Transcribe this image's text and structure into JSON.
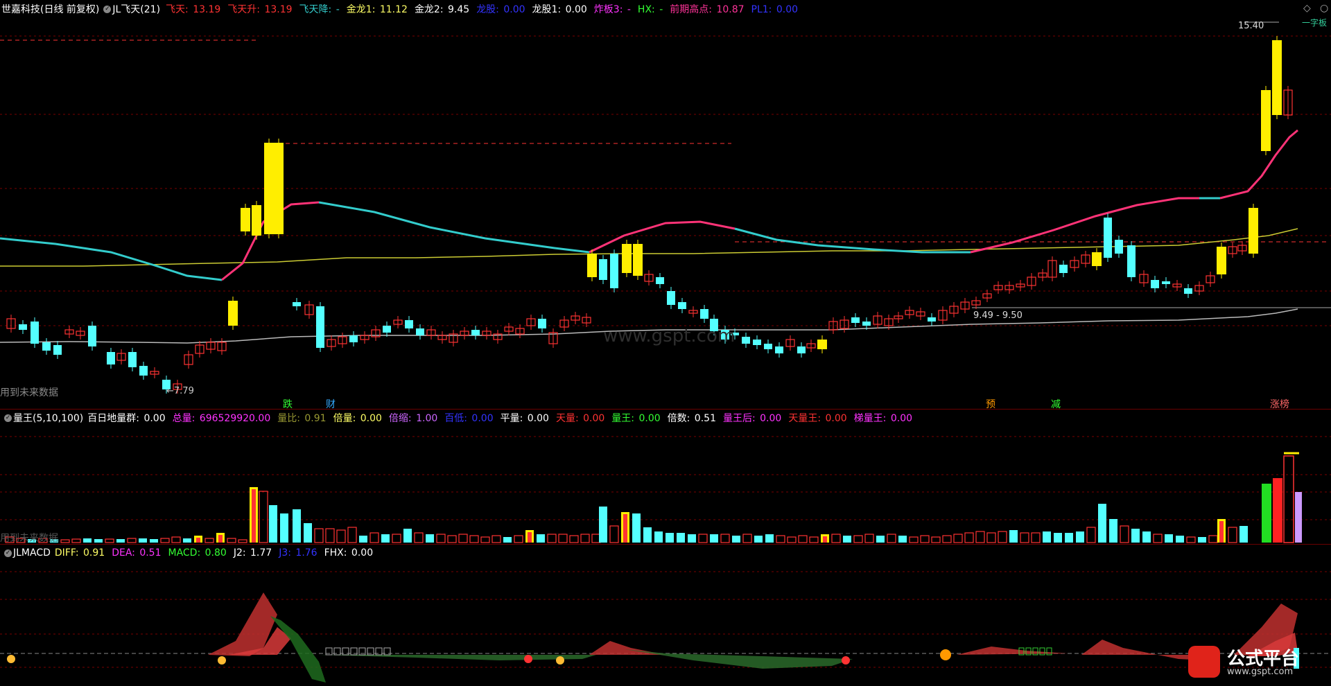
{
  "main": {
    "title": "世嘉科技(日线 前复权)",
    "indicator": "JL飞天(21)",
    "fields": [
      {
        "label": "飞天:",
        "value": "13.19",
        "color": "#ff3333"
      },
      {
        "label": "飞天升:",
        "value": "13.19",
        "color": "#ff3333"
      },
      {
        "label": "飞天降:",
        "value": "-",
        "color": "#33cccc"
      },
      {
        "label": "金龙1:",
        "value": "11.12",
        "color": "#ffff66"
      },
      {
        "label": "金龙2:",
        "value": "9.45",
        "color": "#ffffff"
      },
      {
        "label": "龙股:",
        "value": "0.00",
        "color": "#3333ff"
      },
      {
        "label": "龙股1:",
        "value": "0.00",
        "color": "#ffffff"
      },
      {
        "label": "炸板3:",
        "value": "-",
        "color": "#ff33ff"
      },
      {
        "label": "HX:",
        "value": "-",
        "color": "#33ff33"
      },
      {
        "label": "前期高点:",
        "value": "10.87",
        "color": "#ff3399"
      },
      {
        "label": "PL1:",
        "value": "0.00",
        "color": "#3333ff"
      }
    ],
    "price_high": "15.40",
    "price_low": "7.79",
    "range_label": "9.49 - 9.50",
    "no_future": "用到未来数据",
    "tags": [
      {
        "text": "跌",
        "color": "#33ff33"
      },
      {
        "text": "财",
        "color": "#33aaff"
      },
      {
        "text": "预",
        "color": "#ff9900"
      },
      {
        "text": "减",
        "color": "#33ff33"
      },
      {
        "text": "涨榜",
        "color": "#ff6666"
      }
    ],
    "corner_label": "一字板"
  },
  "volume": {
    "indicator": "量王(5,10,100)",
    "fields": [
      {
        "label": "百日地量群:",
        "value": "0.00",
        "color": "#ffffff"
      },
      {
        "label": "总量:",
        "value": "696529920.00",
        "color": "#ff33ff"
      },
      {
        "label": "量比:",
        "value": "0.91",
        "color": "#999933"
      },
      {
        "label": "倍量:",
        "value": "0.00",
        "color": "#ffff66"
      },
      {
        "label": "倍缩:",
        "value": "1.00",
        "color": "#cc66ff"
      },
      {
        "label": "百低:",
        "value": "0.00",
        "color": "#3333ff"
      },
      {
        "label": "平量:",
        "value": "0.00",
        "color": "#ffffff"
      },
      {
        "label": "天量:",
        "value": "0.00",
        "color": "#ff3333"
      },
      {
        "label": "量王:",
        "value": "0.00",
        "color": "#33ff33"
      },
      {
        "label": "倍数:",
        "value": "0.51",
        "color": "#ffffff"
      },
      {
        "label": "量王后:",
        "value": "0.00",
        "color": "#ff33ff"
      },
      {
        "label": "天量王:",
        "value": "0.00",
        "color": "#ff3333"
      },
      {
        "label": "梯量王:",
        "value": "0.00",
        "color": "#ff33ff"
      }
    ],
    "no_future": "用到未来数据"
  },
  "macd": {
    "indicator": "JLMACD",
    "fields": [
      {
        "label": "DIFF:",
        "value": "0.91",
        "color": "#ffff66"
      },
      {
        "label": "DEA:",
        "value": "0.51",
        "color": "#ff33ff"
      },
      {
        "label": "MACD:",
        "value": "0.80",
        "color": "#33ff33"
      },
      {
        "label": "J2:",
        "value": "1.77",
        "color": "#ffffff"
      },
      {
        "label": "J3:",
        "value": "1.76",
        "color": "#3333ff"
      },
      {
        "label": "FHX:",
        "value": "0.00",
        "color": "#ffffff"
      }
    ]
  },
  "watermark": "www.gspt.com",
  "logo": {
    "name": "公式平台",
    "url": "www.gspt.com"
  },
  "colors": {
    "up": "#ff3333",
    "down": "#54ffff",
    "limit": "#ffee00",
    "grid": "#7a0000",
    "ma_fast_up": "#ff3377",
    "ma_fast_dn": "#33cccc",
    "ma_mid": "#cccc33",
    "ma_slow": "#bbbbbb"
  }
}
